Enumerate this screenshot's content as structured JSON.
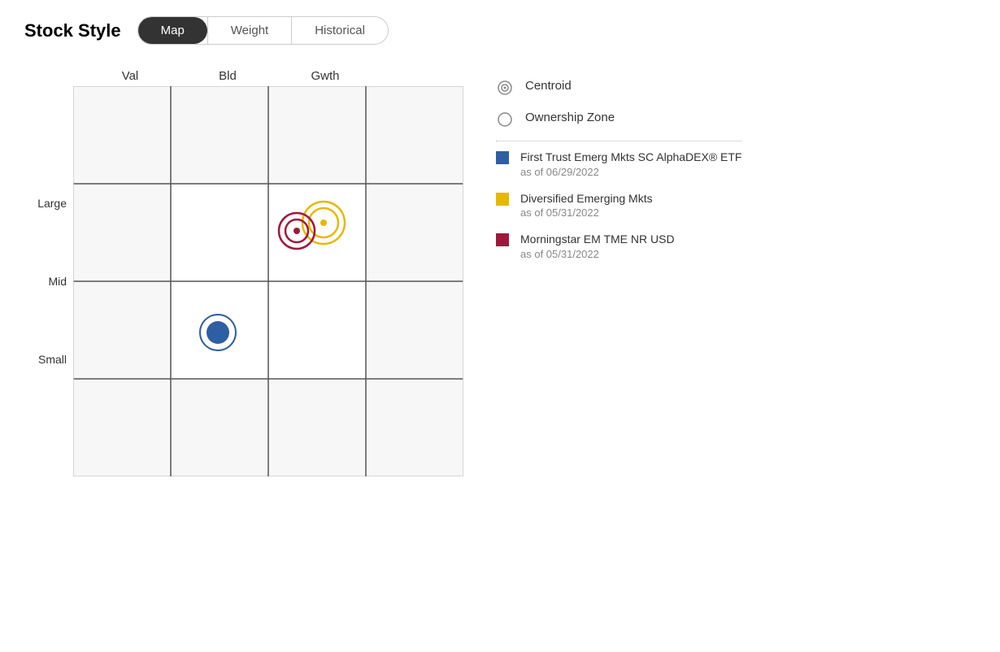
{
  "header": {
    "title": "Stock Style",
    "tabs": [
      {
        "label": "Map",
        "active": true
      },
      {
        "label": "Weight",
        "active": false
      },
      {
        "label": "Historical",
        "active": false
      }
    ]
  },
  "chart": {
    "col_labels": [
      "Val",
      "Bld",
      "Gwth"
    ],
    "row_labels": [
      "Large",
      "Mid",
      "Small"
    ],
    "grid_lines": {
      "outer_border": true,
      "inner_cells": true
    }
  },
  "legend": {
    "centroid_label": "Centroid",
    "ownership_zone_label": "Ownership Zone",
    "funds": [
      {
        "name": "First Trust Emerg Mkts SC AlphaDEX® ETF",
        "date": "as of 06/29/2022",
        "color": "#2e5fa3",
        "color_name": "blue"
      },
      {
        "name": "Diversified Emerging Mkts",
        "date": "as of 05/31/2022",
        "color": "#e6b800",
        "color_name": "yellow"
      },
      {
        "name": "Morningstar EM TME NR USD",
        "date": "as of 05/31/2022",
        "color": "#a0173d",
        "color_name": "dark-red"
      }
    ]
  }
}
